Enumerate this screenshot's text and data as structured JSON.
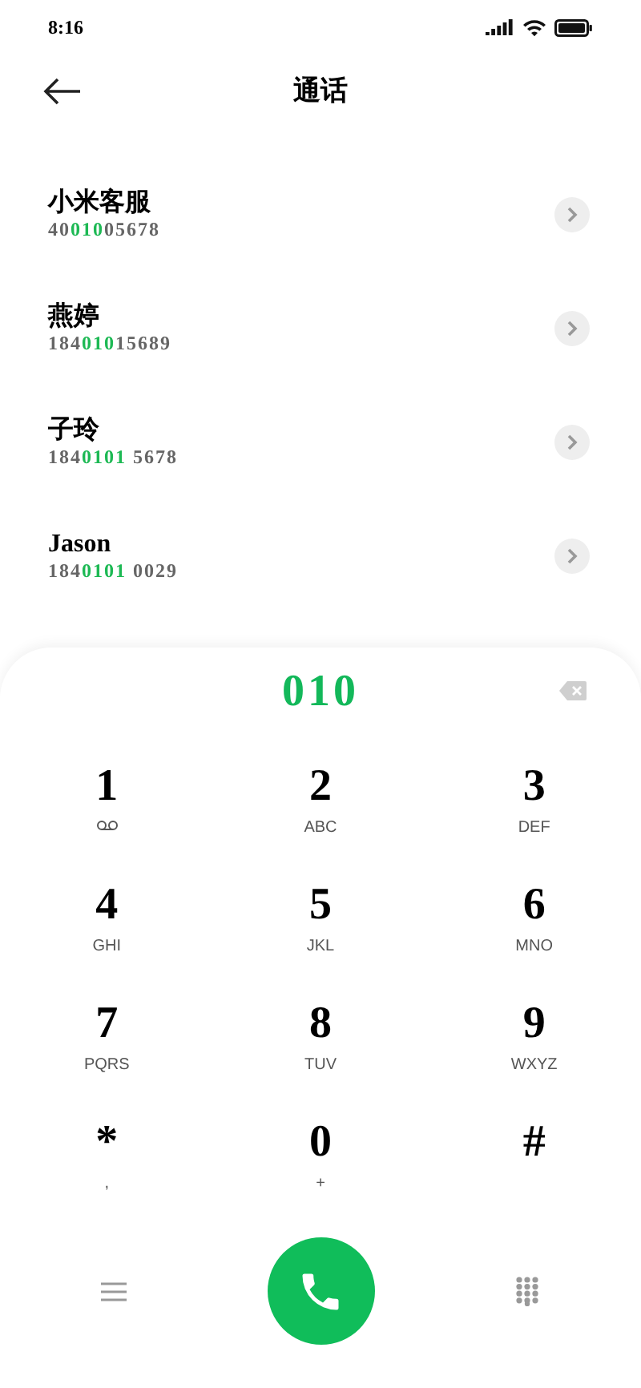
{
  "status_bar": {
    "time": "8:16"
  },
  "header": {
    "title": "通话"
  },
  "contacts": [
    {
      "name": "小米客服",
      "number": [
        {
          "text": "40",
          "match": false
        },
        {
          "text": "010",
          "match": true
        },
        {
          "text": "05678",
          "match": false
        }
      ]
    },
    {
      "name": "燕婷",
      "number": [
        {
          "text": "184",
          "match": false
        },
        {
          "text": "010",
          "match": true
        },
        {
          "text": "15689",
          "match": false
        }
      ]
    },
    {
      "name": "子玲",
      "number": [
        {
          "text": "184",
          "match": false
        },
        {
          "text": "0101",
          "match": true
        },
        {
          "text": " 5678",
          "match": false
        }
      ]
    },
    {
      "name": "Jason",
      "number": [
        {
          "text": "184",
          "match": false
        },
        {
          "text": "0101",
          "match": true
        },
        {
          "text": " 0029",
          "match": false
        }
      ]
    }
  ],
  "dialer": {
    "input": "010",
    "keys": [
      {
        "digit": "1",
        "kind": "voicemail"
      },
      {
        "digit": "2",
        "kind": "letters",
        "sub": "ABC"
      },
      {
        "digit": "3",
        "kind": "letters",
        "sub": "DEF"
      },
      {
        "digit": "4",
        "kind": "letters",
        "sub": "GHI"
      },
      {
        "digit": "5",
        "kind": "letters",
        "sub": "JKL"
      },
      {
        "digit": "6",
        "kind": "letters",
        "sub": "MNO"
      },
      {
        "digit": "7",
        "kind": "letters",
        "sub": "PQRS"
      },
      {
        "digit": "8",
        "kind": "letters",
        "sub": "TUV"
      },
      {
        "digit": "9",
        "kind": "letters",
        "sub": "WXYZ"
      },
      {
        "digit": "*",
        "kind": "letters",
        "sub": ","
      },
      {
        "digit": "0",
        "kind": "letters",
        "sub": "+"
      },
      {
        "digit": "#",
        "kind": "plain"
      }
    ]
  }
}
